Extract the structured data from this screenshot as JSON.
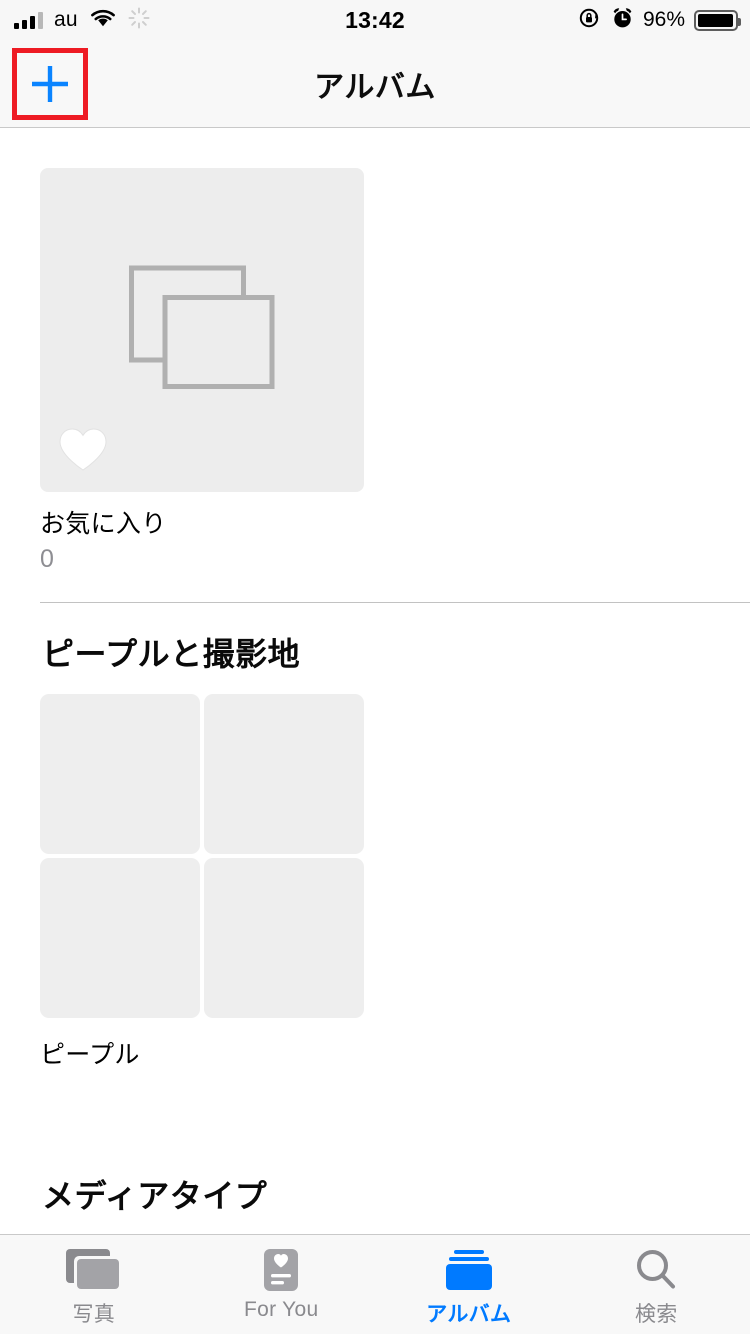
{
  "status_bar": {
    "carrier": "au",
    "time": "13:42",
    "battery_percent": "96%",
    "icons": {
      "signal": "cellular-signal-icon",
      "wifi": "wifi-icon",
      "spinner": "activity-spinner-icon",
      "rotation_lock": "rotation-lock-icon",
      "alarm": "alarm-clock-icon",
      "battery": "battery-icon"
    },
    "signal_bars_filled": 3,
    "signal_bars_total": 4,
    "battery_fill_percent": 96
  },
  "nav_bar": {
    "title": "アルバム",
    "add_button_label": "+",
    "accent_color": "#007aff",
    "annotation_color": "#ee1b24"
  },
  "content": {
    "favorites_album": {
      "name": "お気に入り",
      "count": "0",
      "thumb_icon": "photo-stack-placeholder-icon",
      "badge_icon": "heart-icon"
    },
    "sections": [
      {
        "header": "ピープルと撮影地",
        "tiles": [
          {
            "name": "ピープル",
            "cells": 4
          }
        ]
      },
      {
        "header": "メディアタイプ",
        "tiles": []
      }
    ]
  },
  "tab_bar": {
    "active_index": 2,
    "active_color": "#007aff",
    "inactive_color": "#8a8a8e",
    "tabs": [
      {
        "label": "写真",
        "icon": "photos-stack-icon"
      },
      {
        "label": "For You",
        "icon": "for-you-card-icon"
      },
      {
        "label": "アルバム",
        "icon": "albums-icon"
      },
      {
        "label": "検索",
        "icon": "search-magnifier-icon"
      }
    ]
  }
}
